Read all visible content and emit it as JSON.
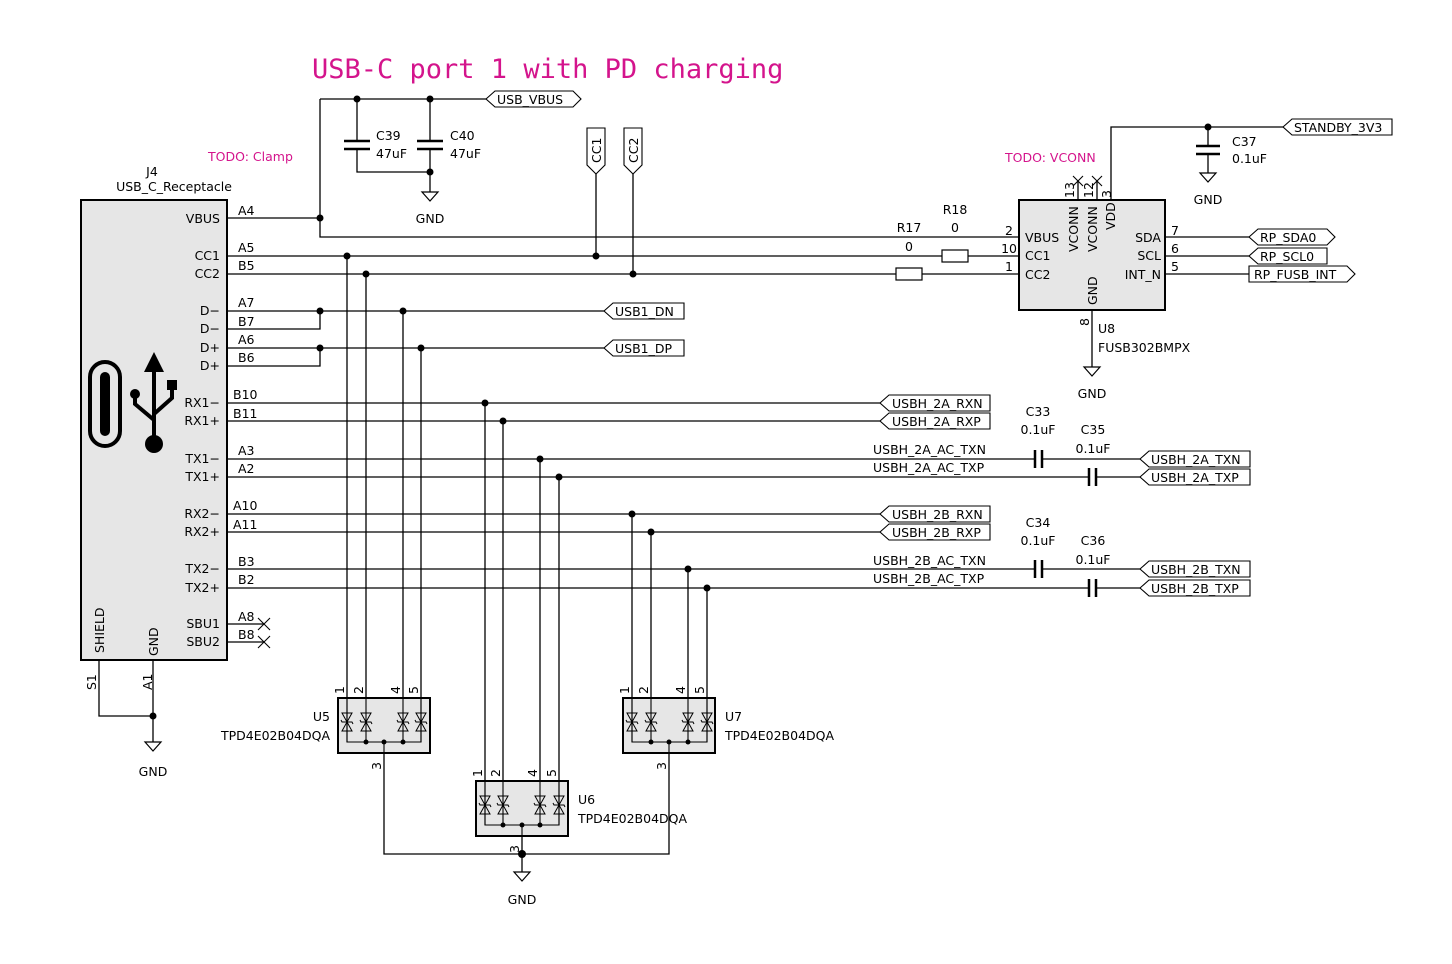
{
  "title": "USB-C port 1 with PD charging",
  "colors": {
    "annotation": "#d4148c",
    "body_fill": "#e6e6e6",
    "wire": "#000000"
  },
  "notes": {
    "clamp": "TODO: Clamp",
    "vconn": "TODO: VCONN"
  },
  "j4": {
    "ref": "J4",
    "value": "USB_C_Receptacle",
    "pins": [
      {
        "name": "VBUS",
        "num": "A4"
      },
      {
        "name": "CC1",
        "num": "A5"
      },
      {
        "name": "CC2",
        "num": "B5"
      },
      {
        "name": "D−",
        "num": "A7"
      },
      {
        "name": "D−",
        "num": "B7"
      },
      {
        "name": "D+",
        "num": "A6"
      },
      {
        "name": "D+",
        "num": "B6"
      },
      {
        "name": "RX1−",
        "num": "B10"
      },
      {
        "name": "RX1+",
        "num": "B11"
      },
      {
        "name": "TX1−",
        "num": "A3"
      },
      {
        "name": "TX1+",
        "num": "A2"
      },
      {
        "name": "RX2−",
        "num": "A10"
      },
      {
        "name": "RX2+",
        "num": "A11"
      },
      {
        "name": "TX2−",
        "num": "B3"
      },
      {
        "name": "TX2+",
        "num": "B2"
      },
      {
        "name": "SBU1",
        "num": "A8"
      },
      {
        "name": "SBU2",
        "num": "B8"
      }
    ],
    "bottom_pins": [
      {
        "name": "SHIELD",
        "num": "S1"
      },
      {
        "name": "GND",
        "num": "A1"
      }
    ],
    "icon": "usb-c-icon"
  },
  "caps": {
    "c39": {
      "ref": "C39",
      "value": "47uF"
    },
    "c40": {
      "ref": "C40",
      "value": "47uF"
    },
    "c37": {
      "ref": "C37",
      "value": "0.1uF"
    },
    "c33": {
      "ref": "C33",
      "value": "0.1uF"
    },
    "c35": {
      "ref": "C35",
      "value": "0.1uF"
    },
    "c34": {
      "ref": "C34",
      "value": "0.1uF"
    },
    "c36": {
      "ref": "C36",
      "value": "0.1uF"
    }
  },
  "resistors": {
    "r17": {
      "ref": "R17",
      "value": "0"
    },
    "r18": {
      "ref": "R18",
      "value": "0"
    }
  },
  "u8": {
    "ref": "U8",
    "value": "FUSB302BMPX",
    "left_pins": [
      {
        "name": "VBUS",
        "num": "2"
      },
      {
        "name": "CC1",
        "num": "10"
      },
      {
        "name": "CC2",
        "num": "1"
      }
    ],
    "right_pins": [
      {
        "name": "SDA",
        "num": "7"
      },
      {
        "name": "SCL",
        "num": "6"
      },
      {
        "name": "INT_N",
        "num": "5"
      }
    ],
    "top_pins": [
      {
        "name": "VCONN",
        "num": "13"
      },
      {
        "name": "VCONN",
        "num": "12"
      },
      {
        "name": "VDD",
        "num": "3"
      }
    ],
    "bottom_pin": {
      "name": "GND",
      "num": "8"
    }
  },
  "esd": [
    {
      "ref": "U5",
      "value": "TPD4E02B04DQA",
      "pins": [
        "1",
        "2",
        "4",
        "5"
      ],
      "gnd_pin": "3"
    },
    {
      "ref": "U6",
      "value": "TPD4E02B04DQA",
      "pins": [
        "1",
        "2",
        "4",
        "5"
      ],
      "gnd_pin": "3"
    },
    {
      "ref": "U7",
      "value": "TPD4E02B04DQA",
      "pins": [
        "1",
        "2",
        "4",
        "5"
      ],
      "gnd_pin": "3"
    }
  ],
  "net_labels": {
    "usb_vbus": "USB_VBUS",
    "cc1": "CC1",
    "cc2": "CC2",
    "standby_3v3": "STANDBY_3V3",
    "rp_sda0": "RP_SDA0",
    "rp_scl0": "RP_SCL0",
    "rp_fusb_int": "RP_FUSB_INT",
    "usb1_dn": "USB1_DN",
    "usb1_dp": "USB1_DP",
    "usbh_2a_rxn": "USBH_2A_RXN",
    "usbh_2a_rxp": "USBH_2A_RXP",
    "usbh_2a_txn": "USBH_2A_TXN",
    "usbh_2a_txp": "USBH_2A_TXP",
    "usbh_2b_rxn": "USBH_2B_RXN",
    "usbh_2b_rxp": "USBH_2B_RXP",
    "usbh_2b_txn": "USBH_2B_TXN",
    "usbh_2b_txp": "USBH_2B_TXP"
  },
  "wire_labels": {
    "usbh_2a_ac_txn": "USBH_2A_AC_TXN",
    "usbh_2a_ac_txp": "USBH_2A_AC_TXP",
    "usbh_2b_ac_txn": "USBH_2B_AC_TXN",
    "usbh_2b_ac_txp": "USBH_2B_AC_TXP"
  },
  "gnd_label": "GND"
}
